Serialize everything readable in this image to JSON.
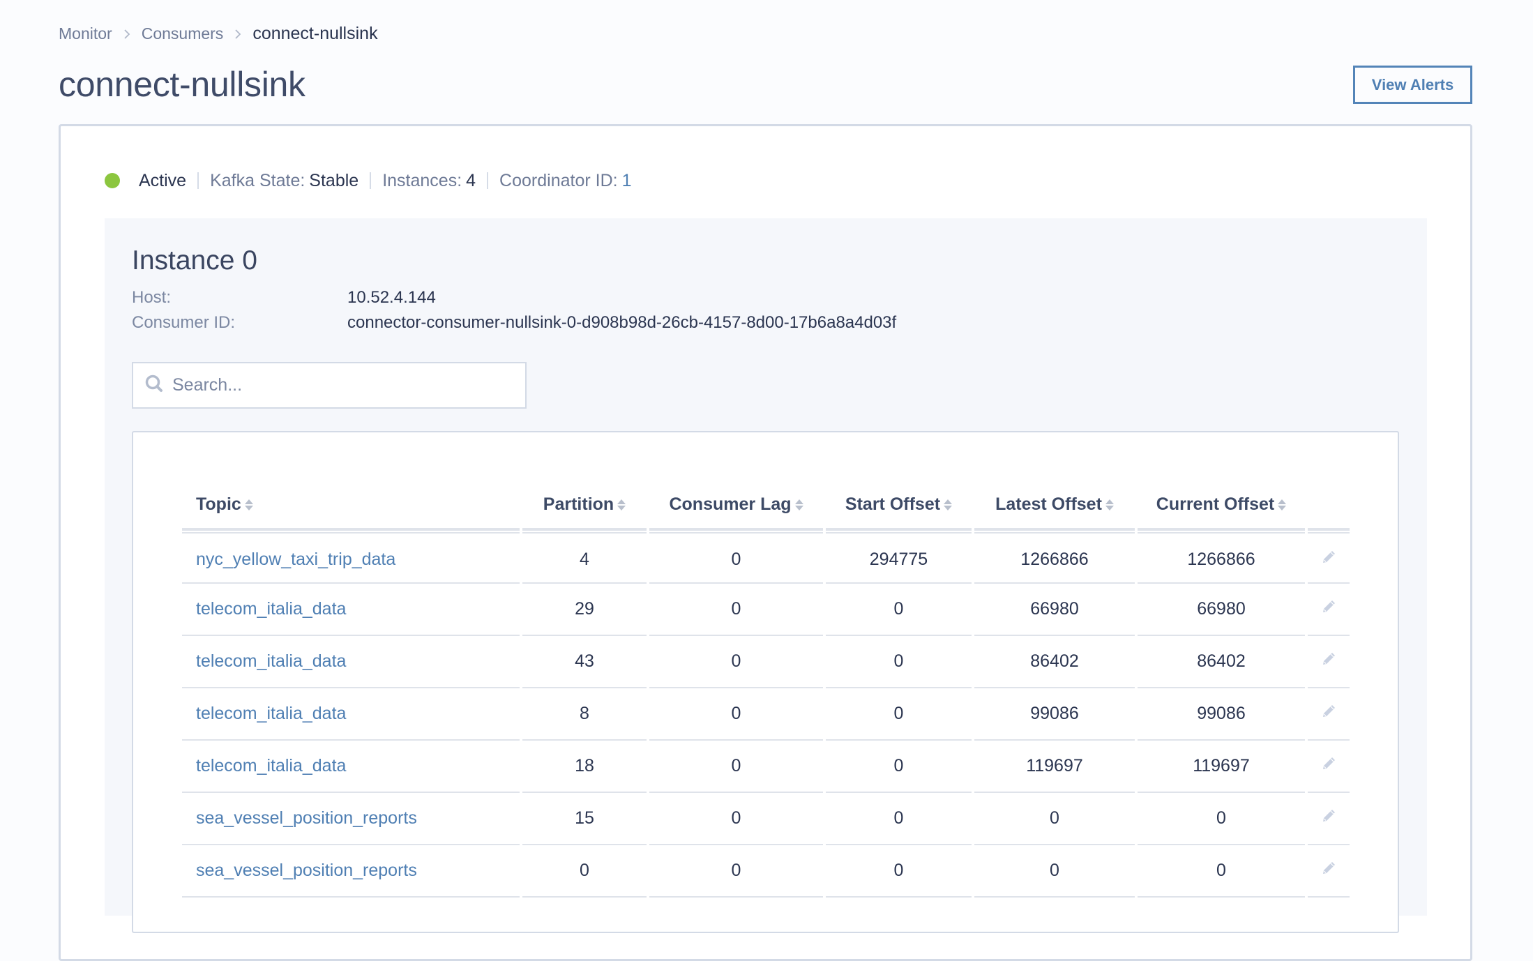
{
  "breadcrumb": {
    "items": [
      {
        "label": "Monitor"
      },
      {
        "label": "Consumers"
      },
      {
        "label": "connect-nullsink"
      }
    ]
  },
  "page": {
    "title": "connect-nullsink",
    "view_alerts_label": "View Alerts"
  },
  "status": {
    "state": "Active",
    "state_color": "#8cc63f",
    "kafka_state_label": "Kafka State:",
    "kafka_state_value": "Stable",
    "instances_label": "Instances:",
    "instances_value": "4",
    "coordinator_label": "Coordinator ID:",
    "coordinator_value": "1"
  },
  "instance": {
    "title": "Instance 0",
    "host_label": "Host:",
    "host_value": "10.52.4.144",
    "consumer_id_label": "Consumer ID:",
    "consumer_id_value": "connector-consumer-nullsink-0-d908b98d-26cb-4157-8d00-17b6a8a4d03f"
  },
  "search": {
    "placeholder": "Search...",
    "value": ""
  },
  "table": {
    "columns": [
      {
        "label": "Topic"
      },
      {
        "label": "Partition"
      },
      {
        "label": "Consumer Lag"
      },
      {
        "label": "Start Offset"
      },
      {
        "label": "Latest Offset"
      },
      {
        "label": "Current Offset"
      }
    ],
    "rows": [
      {
        "topic": "nyc_yellow_taxi_trip_data",
        "partition": "4",
        "lag": "0",
        "start": "294775",
        "latest": "1266866",
        "current": "1266866"
      },
      {
        "topic": "telecom_italia_data",
        "partition": "29",
        "lag": "0",
        "start": "0",
        "latest": "66980",
        "current": "66980"
      },
      {
        "topic": "telecom_italia_data",
        "partition": "43",
        "lag": "0",
        "start": "0",
        "latest": "86402",
        "current": "86402"
      },
      {
        "topic": "telecom_italia_data",
        "partition": "8",
        "lag": "0",
        "start": "0",
        "latest": "99086",
        "current": "99086"
      },
      {
        "topic": "telecom_italia_data",
        "partition": "18",
        "lag": "0",
        "start": "0",
        "latest": "119697",
        "current": "119697"
      },
      {
        "topic": "sea_vessel_position_reports",
        "partition": "15",
        "lag": "0",
        "start": "0",
        "latest": "0",
        "current": "0"
      },
      {
        "topic": "sea_vessel_position_reports",
        "partition": "0",
        "lag": "0",
        "start": "0",
        "latest": "0",
        "current": "0"
      }
    ],
    "row_action_icon": "pencil-icon"
  }
}
